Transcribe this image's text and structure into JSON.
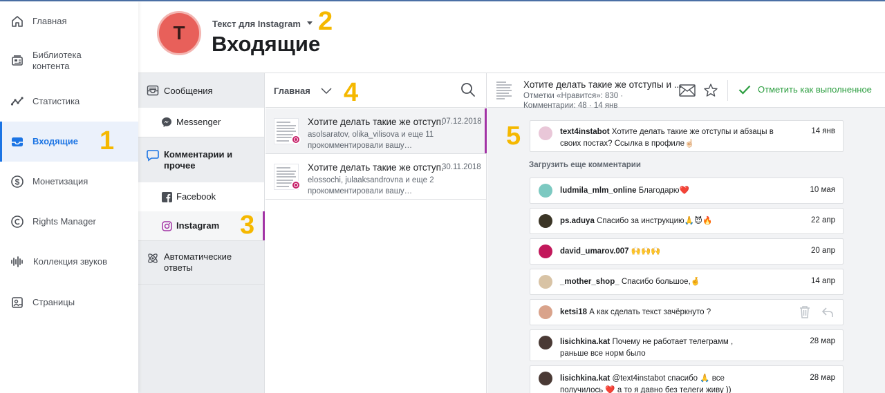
{
  "left_nav": {
    "items": [
      {
        "label": "Главная",
        "icon": "home-icon"
      },
      {
        "label": "Библиотека контента",
        "icon": "library-icon"
      },
      {
        "label": "Статистика",
        "icon": "stats-icon"
      },
      {
        "label": "Входящие",
        "icon": "inbox-icon",
        "active": true
      },
      {
        "label": "Монетизация",
        "icon": "dollar-icon"
      },
      {
        "label": "Rights Manager",
        "icon": "copyright-icon"
      },
      {
        "label": "Коллекция звуков",
        "icon": "sound-icon"
      },
      {
        "label": "Страницы",
        "icon": "pages-icon"
      }
    ]
  },
  "markers": [
    "1",
    "2",
    "3",
    "4",
    "5"
  ],
  "header": {
    "avatar_letter": "T",
    "page_name": "Текст для Instagram",
    "title": "Входящие"
  },
  "subnav": {
    "messages": "Сообщения",
    "messenger": "Messenger",
    "comments": "Комментарии и прочее",
    "facebook": "Facebook",
    "instagram": "Instagram",
    "auto": "Автоматические ответы"
  },
  "thread_list": {
    "title": "Главная",
    "threads": [
      {
        "title": "Хотите делать такие же отступ...",
        "date": "07.12.2018",
        "subtitle": "asolsaratov, olika_vilisova и еще 11 прокомментировали вашу…"
      },
      {
        "title": "Хотите делать такие же отступ...",
        "date": "30.11.2018",
        "subtitle": "elossochi, julaaksandrovna и еще 2 прокомментировали вашу…"
      }
    ]
  },
  "detail": {
    "title": "Хотите делать такие же отступы и ...",
    "meta_likes": "Отметки «Нравится»: 830 ·",
    "meta_comments": "Комментарии: 48 · 14 янв",
    "mark_done": "Отметить как выполненное",
    "load_more": "Загрузить еще комментарии",
    "post": {
      "user": "text4instabot",
      "text": "Хотите делать такие же отступы и абзацы в своих постах? Ссылка в профиле☝🏻",
      "date": "14 янв"
    },
    "comments": [
      {
        "user": "ludmila_mlm_online",
        "text": "Благодарю❤️",
        "date": "10 мая",
        "avatar_color": "#7cc9c1"
      },
      {
        "user": "ps.aduya",
        "text": "Спасибо за инструкцию🙏😈🔥",
        "date": "22 апр",
        "avatar_color": "#3b3526"
      },
      {
        "user": "david_umarov.007",
        "text": "🙌🙌🙌",
        "date": "20 апр",
        "avatar_color": "#c2185b"
      },
      {
        "user": "_mother_shop_",
        "text": "Спасибо большое,🤞",
        "date": "14 апр",
        "avatar_color": "#d8c3a5"
      },
      {
        "user": "ketsi18",
        "text": "А как сделать текст зачёркнуто ?",
        "date": "",
        "avatar_color": "#d9a38b"
      },
      {
        "user": "lisichkina.kat",
        "text": "Почему не работает телеграмм , раньше все норм было",
        "date": "28 мар",
        "avatar_color": "#4a3a35"
      },
      {
        "user": "lisichkina.kat",
        "text": "@text4instabot спасибо 🙏 все получилось ❤️ а то я давно без телеги живу ))",
        "date": "28 мар",
        "avatar_color": "#4a3a35"
      }
    ]
  }
}
